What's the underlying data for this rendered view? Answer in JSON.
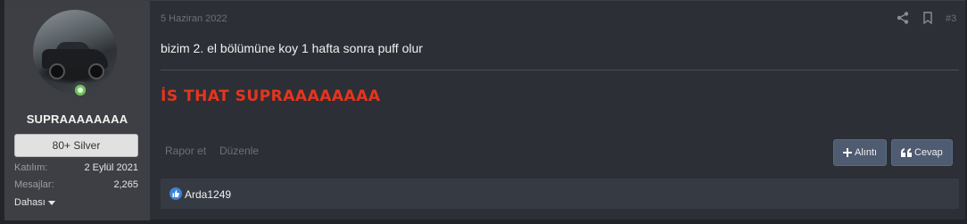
{
  "user": {
    "username": "SUPRAAAAAAAA",
    "rank": "80+ Silver",
    "joined_label": "Katılım:",
    "joined_value": "2 Eylül 2021",
    "posts_label": "Mesajlar:",
    "posts_value": "2,265",
    "more_label": "Dahası"
  },
  "post": {
    "date": "5 Haziran 2022",
    "number": "#3",
    "message": "bizim 2. el bölümüne koy 1 hafta sonra puff olur",
    "highlight": "İS THAT SUPRAAAAAAAA",
    "highlight_color": "#e8341c"
  },
  "actions": {
    "report": "Rapor et",
    "edit": "Düzenle",
    "quote": "Alıntı",
    "reply": "Cevap"
  },
  "reactions": {
    "users": "Arda1249"
  },
  "icons": [
    "share-icon",
    "bookmark-icon",
    "plus-icon",
    "quote-icon",
    "like-icon"
  ]
}
